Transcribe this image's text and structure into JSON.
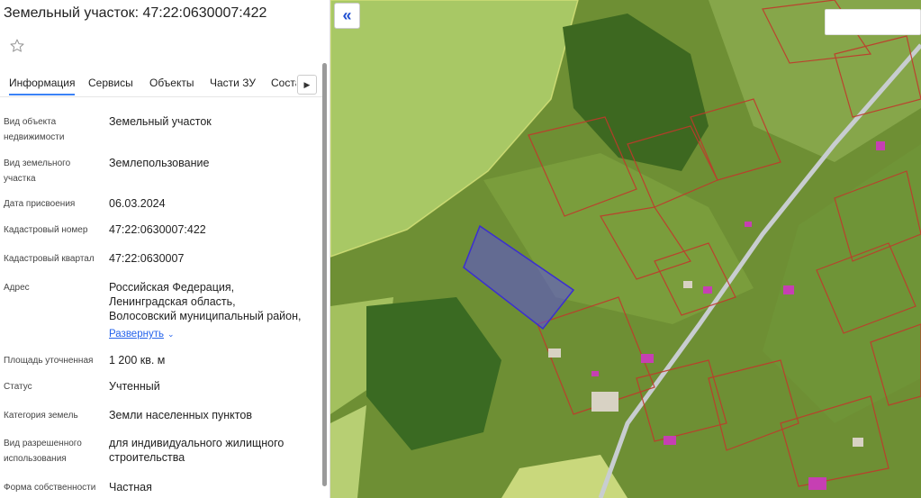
{
  "header": {
    "title": "Земельный участок: 47:22:0630007:422"
  },
  "icons": {
    "favorite": "star-outline-icon",
    "collapse": "double-chevron-left-icon",
    "tab_next": "chevron-right-icon",
    "expand": "chevron-down-icon"
  },
  "tabs": [
    {
      "label": "Информация",
      "active": true
    },
    {
      "label": "Сервисы"
    },
    {
      "label": "Объекты"
    },
    {
      "label": "Части ЗУ"
    },
    {
      "label": "Соста"
    }
  ],
  "info": {
    "object_type": {
      "label": [
        "Вид объекта",
        "недвижимости"
      ],
      "value": "Земельный участок"
    },
    "land_type": {
      "label": [
        "Вид земельного",
        "участка"
      ],
      "value": "Землепользование"
    },
    "assign_date": {
      "label": "Дата присвоения",
      "value": "06.03.2024"
    },
    "cadastral_no": {
      "label": "Кадастровый номер",
      "value": "47:22:0630007:422"
    },
    "cadastral_qtr": {
      "label": "Кадастровый квартал",
      "value": "47:22:0630007"
    },
    "address": {
      "label": "Адрес",
      "value": [
        "Российская Федерация,",
        "Ленинградская область,",
        "Волосовский муниципальный район,"
      ],
      "expand_label": "Развернуть"
    },
    "area": {
      "label": "Площадь уточненная",
      "value": "1 200 кв. м"
    },
    "status": {
      "label": "Статус",
      "value": "Учтенный"
    },
    "land_category": {
      "label": "Категория земель",
      "value": "Земли населенных пунктов"
    },
    "permitted_use": {
      "label": [
        "Вид разрешенного",
        "использования"
      ],
      "value": [
        "для индивидуального жилищного",
        "строительства"
      ]
    },
    "ownership": {
      "label": "Форма собственности",
      "value": "Частная"
    }
  },
  "colors": {
    "accent": "#2563eb",
    "parcel_highlight": "#5b4fe0",
    "parcel_border": "#c0392b",
    "field": "#9fc35a",
    "forest": "#3f6b22"
  }
}
